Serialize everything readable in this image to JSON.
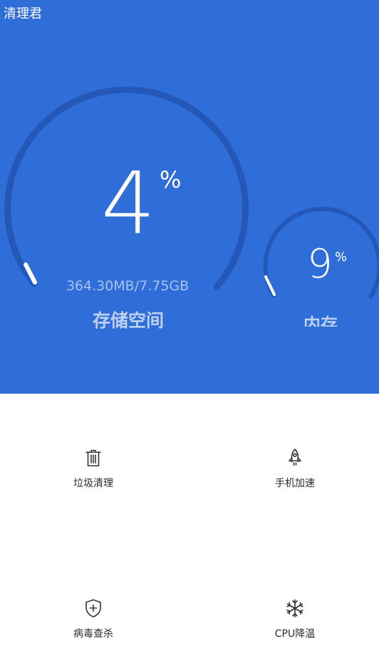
{
  "app": {
    "title": "清理君"
  },
  "storage": {
    "percent_value": "4",
    "percent_sign": "%",
    "detail": "364.30MB/7.75GB",
    "label": "存储空间",
    "usage_fraction": 0.04
  },
  "memory": {
    "percent_value": "9",
    "percent_sign": "%",
    "label": "内存",
    "usage_fraction": 0.09
  },
  "tools": [
    {
      "label": "垃圾清理",
      "icon": "trash-icon"
    },
    {
      "label": "手机加速",
      "icon": "rocket-icon"
    },
    {
      "label": "病毒查杀",
      "icon": "shield-plus-icon"
    },
    {
      "label": "CPU降温",
      "icon": "snowflake-icon"
    }
  ],
  "colors": {
    "primary": "#2f6dd8",
    "ring_track": "#2458b8",
    "ring_fill": "#ffffff",
    "sub_text": "#a9c3ee"
  }
}
